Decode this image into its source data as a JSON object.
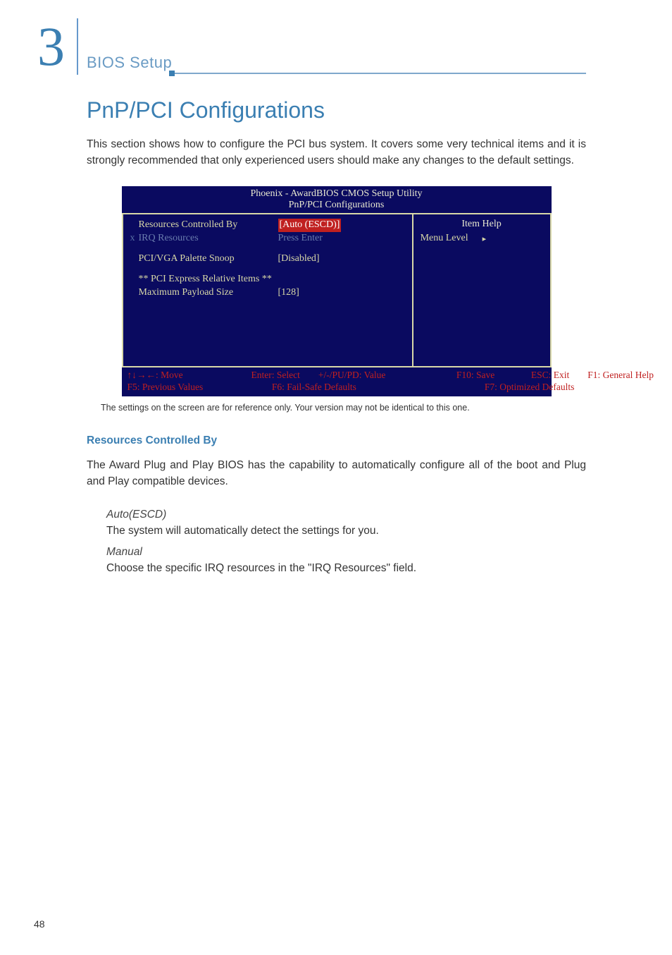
{
  "page": {
    "chapter_number": "3",
    "section_label": "BIOS Setup",
    "heading": "PnP/PCI Configurations",
    "intro": "This section shows how to configure the PCI bus system. It covers some very technical items and it is strongly recommended that only experienced users should make any changes to the default settings.",
    "caption": "The settings on the screen are for reference only. Your version may not be identical to this one.",
    "sub1_title": "Resources Controlled By",
    "sub1_body": "The Award Plug and Play BIOS has the capability to automatically configure all of the boot and Plug and Play compatible devices.",
    "opt1_term": "Auto(ESCD)",
    "opt1_desc": "The system will automatically detect the settings for you.",
    "opt2_term": "Manual",
    "opt2_desc": "Choose the specific IRQ resources in the \"IRQ Resources\" field.",
    "page_number": "48"
  },
  "bios": {
    "title_line1": "Phoenix - AwardBIOS CMOS Setup Utility",
    "title_line2": "PnP/PCI Configurations",
    "rows": {
      "r1_label": "Resources Controlled By",
      "r1_value": "[Auto (ESCD)]",
      "r2_x": "x",
      "r2_label": "IRQ Resources",
      "r2_value": "Press Enter",
      "r3_label": "PCI/VGA Palette Snoop",
      "r3_value": "[Disabled]",
      "r4_label": "** PCI Express Relative Items **",
      "r5_label": "Maximum Payload Size",
      "r5_value": "[128]"
    },
    "help": {
      "title": "Item Help",
      "menu_level": "Menu Level",
      "arrow": "▸"
    },
    "footer": {
      "move": "↑↓→←: Move",
      "enter": "Enter: Select",
      "pupd": "+/-/PU/PD: Value",
      "f10": "F10: Save",
      "esc": "ESC: Exit",
      "f1": "F1: General Help",
      "f5": "F5: Previous Values",
      "f6": "F6: Fail-Safe Defaults",
      "f7": "F7: Optimized Defaults"
    }
  }
}
